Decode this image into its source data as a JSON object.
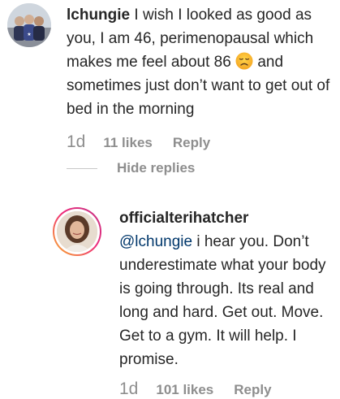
{
  "comments": [
    {
      "username": "lchungie",
      "text_before_emoji": " I wish I looked as good as you, I am 46, perimenopausal which makes me feel about 86 ",
      "emoji_icon": "disappointed-face-emoji",
      "text_after_emoji": " and sometimes just don’t want to get out of bed in the morning",
      "time": "1d",
      "likes": "11 likes",
      "reply_label": "Reply"
    }
  ],
  "hide_replies_label": "Hide replies",
  "replies": [
    {
      "username": "officialterihatcher",
      "mention": "@lchungie",
      "text": " i hear you. Don’t underestimate what your body is going through. Its real and long and hard. Get out. Move. Get to a gym. It will help. I promise.",
      "time": "1d",
      "likes": "101 likes",
      "reply_label": "Reply",
      "avatar_ring_colors": [
        "#f9b42b",
        "#ee2a7b",
        "#c13584"
      ]
    }
  ],
  "colors": {
    "text": "#262626",
    "meta": "#8e8e8e",
    "mention": "#00376b"
  }
}
